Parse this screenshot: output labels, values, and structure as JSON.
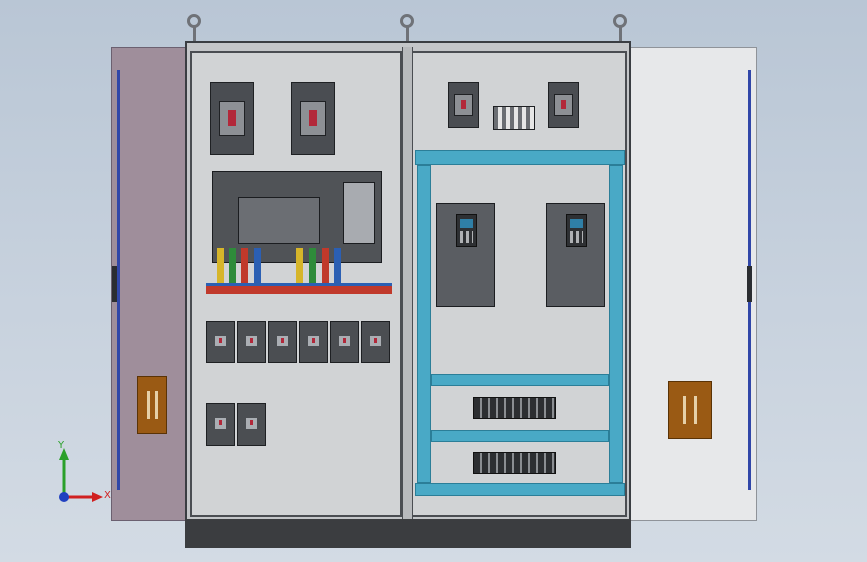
{
  "axes": {
    "y_label": "Y",
    "x_label": "X"
  },
  "colors": {
    "rail": "#49a9c6",
    "door_left": "#9f8e9b",
    "door_right": "#e7e8ea",
    "handle": "#9a5a14",
    "axis_y": "#2aa02a",
    "axis_x": "#d02020",
    "axis_origin": "#2040c0"
  },
  "icons": [
    "eyebolt-icon",
    "door-handle-icon",
    "axis-triad-icon"
  ]
}
